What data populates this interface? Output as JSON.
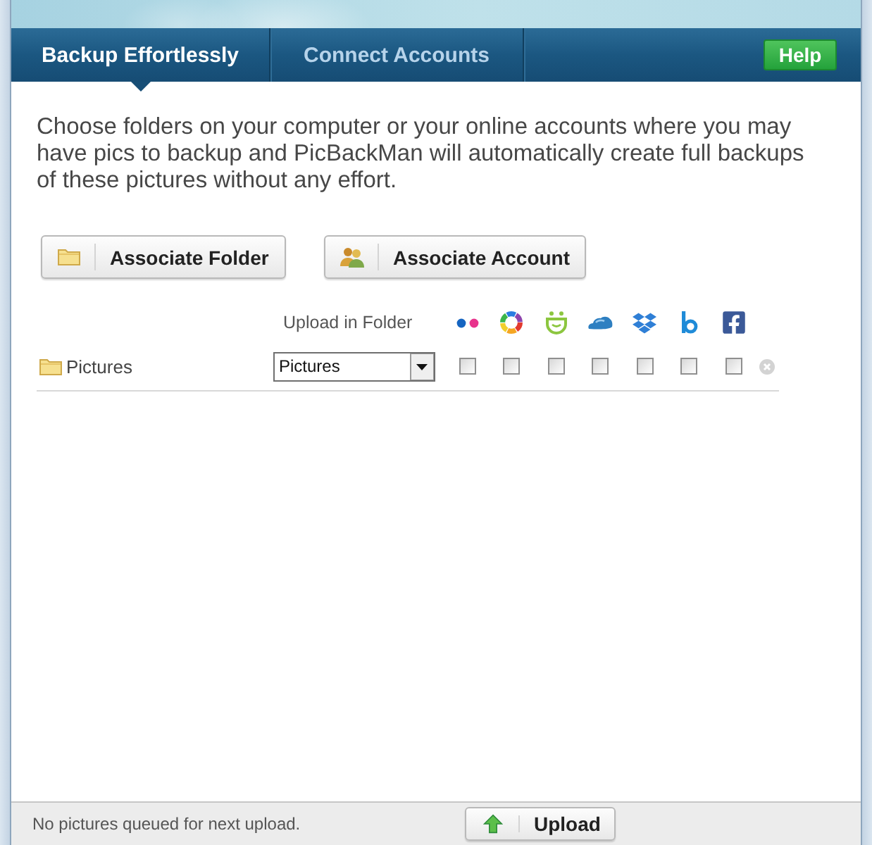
{
  "tabs": [
    {
      "label": "Backup Effortlessly",
      "selected": true
    },
    {
      "label": "Connect Accounts",
      "selected": false
    }
  ],
  "help_button": {
    "label": "Help"
  },
  "intro": "Choose folders on your computer or your online accounts where you may have pics to backup and PicBackMan will automatically create full backups of these pictures without any effort.",
  "actions": [
    {
      "label": "Associate Folder",
      "kind": "folder"
    },
    {
      "label": "Associate Account",
      "kind": "account"
    }
  ],
  "table": {
    "column_header": "Upload in Folder",
    "rows": [
      {
        "name": "Pictures",
        "upload_folder": "Pictures",
        "services": [
          {
            "checked": false
          },
          {
            "checked": false
          },
          {
            "checked": false
          },
          {
            "checked": false
          },
          {
            "checked": false
          },
          {
            "checked": false
          },
          {
            "checked": false
          }
        ]
      }
    ]
  },
  "status_bar": {
    "message": "No pictures queued for next upload.",
    "upload_button": {
      "label": "Upload"
    }
  }
}
